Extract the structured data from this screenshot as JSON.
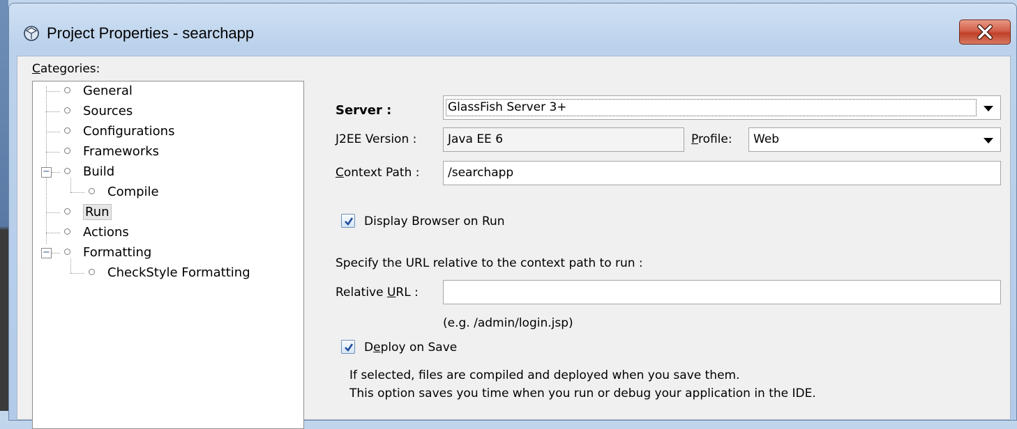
{
  "window": {
    "title": "Project Properties - searchapp",
    "icon": "cube-icon"
  },
  "categories": {
    "label_mnemonic": "C",
    "label_rest": "ategories:",
    "items": [
      {
        "label": "General"
      },
      {
        "label": "Sources"
      },
      {
        "label": "Configurations"
      },
      {
        "label": "Frameworks"
      },
      {
        "label": "Build"
      },
      {
        "label": "Compile"
      },
      {
        "label": "Run"
      },
      {
        "label": "Actions"
      },
      {
        "label": "Formatting"
      },
      {
        "label": "CheckStyle Formatting"
      }
    ],
    "selected": "Run"
  },
  "run": {
    "server_label": "Server :",
    "server_value": "GlassFish Server 3+",
    "j2ee_label": "J2EE Version :",
    "j2ee_value": "Java EE 6",
    "profile_label_mnemonic": "P",
    "profile_label_rest": "rofile:",
    "profile_value": "Web",
    "context_label_mnemonic": "C",
    "context_label_rest": "ontext Path :",
    "context_value": "/searchapp",
    "display_browser_label": "Display Browser on Run",
    "display_browser_checked": true,
    "specify_url_text": "Specify the URL relative to the context path to run :",
    "relative_url_label_pre": "Relative ",
    "relative_url_label_mnemonic": "U",
    "relative_url_label_post": "RL :",
    "relative_url_value": "",
    "relative_url_example": "(e.g. /admin/login.jsp)",
    "deploy_label_pre": "D",
    "deploy_label_mnemonic": "e",
    "deploy_label_post": "ploy on Save",
    "deploy_checked": true,
    "deploy_note_line1": "If selected, files are compiled and deployed when you save them.",
    "deploy_note_line2": "This option saves you time when you run or debug your application in the IDE."
  }
}
